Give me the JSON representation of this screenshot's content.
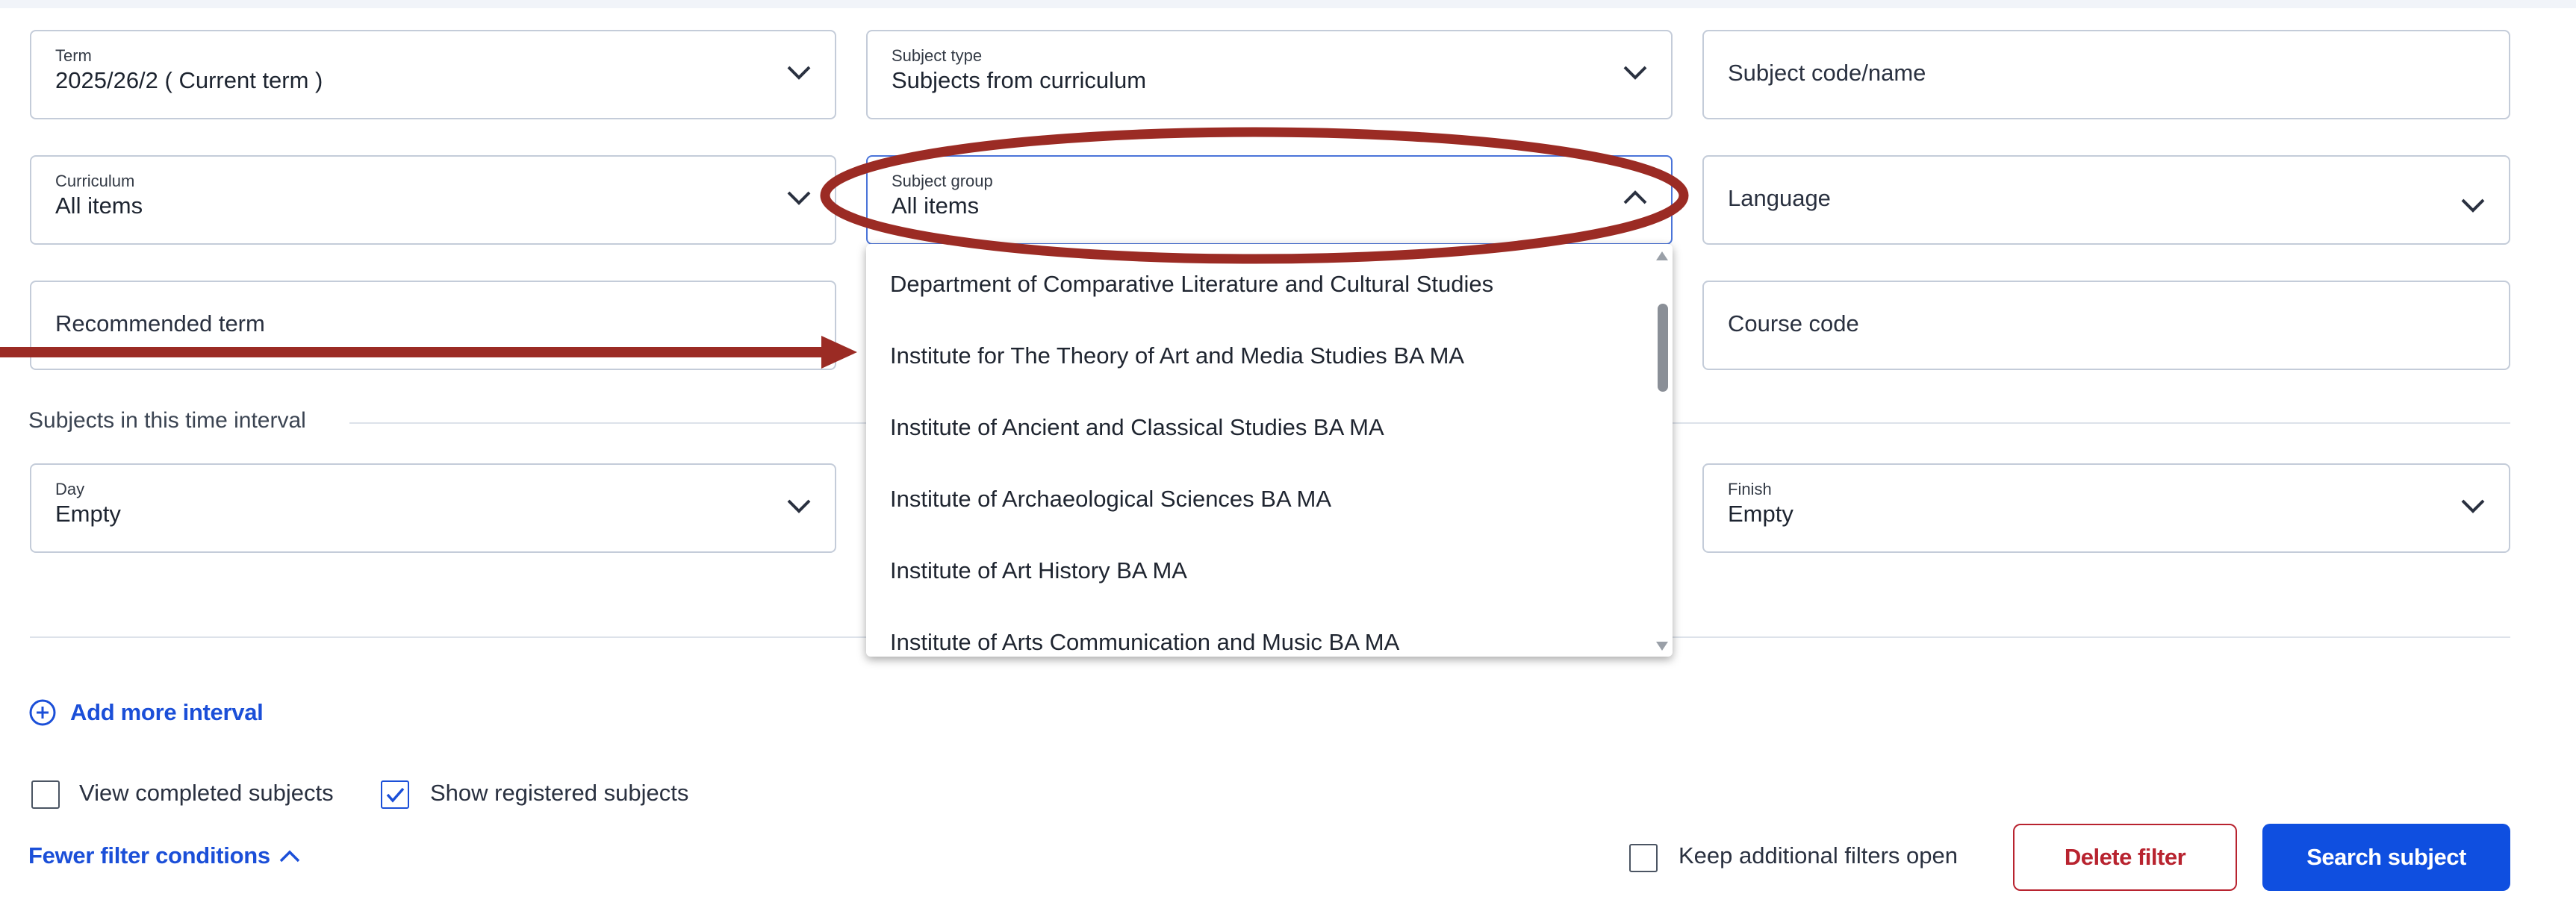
{
  "filters": {
    "term": {
      "label": "Term",
      "value": "2025/26/2 ( Current term )"
    },
    "subject_type": {
      "label": "Subject type",
      "value": "Subjects from curriculum"
    },
    "subject_code_name": {
      "placeholder": "Subject code/name"
    },
    "curriculum": {
      "label": "Curriculum",
      "value": "All items"
    },
    "subject_group": {
      "label": "Subject group",
      "value": "All items",
      "expanded": true
    },
    "language": {
      "placeholder": "Language"
    },
    "recommended_term": {
      "placeholder": "Recommended term"
    },
    "course_code": {
      "placeholder": "Course code"
    }
  },
  "interval": {
    "section_label": "Subjects in this time interval",
    "day": {
      "label": "Day",
      "value": "Empty"
    },
    "finish": {
      "label": "Finish",
      "value": "Empty"
    },
    "add_more": "Add more interval"
  },
  "dropdown": {
    "items": [
      "Department of Comparative Literature and Cultural Studies",
      "Institute for The Theory of Art and Media Studies BA MA",
      "Institute of Ancient and Classical Studies BA MA",
      "Institute of Archaeological Sciences BA MA",
      "Institute of Art History BA MA",
      "Institute of Arts Communication and Music BA MA"
    ]
  },
  "options": {
    "view_completed": {
      "label": "View completed subjects",
      "checked": false
    },
    "show_registered": {
      "label": "Show registered subjects",
      "checked": true
    },
    "fewer_filters": "Fewer filter conditions",
    "keep_open": {
      "label": "Keep additional filters open",
      "checked": false
    }
  },
  "buttons": {
    "delete_filter": "Delete filter",
    "search_subject": "Search subject"
  },
  "colors": {
    "accent": "#1b4fd8",
    "primary_button": "#0f4fe0",
    "danger": "#b8232f",
    "annotation": "#9b2b24"
  }
}
